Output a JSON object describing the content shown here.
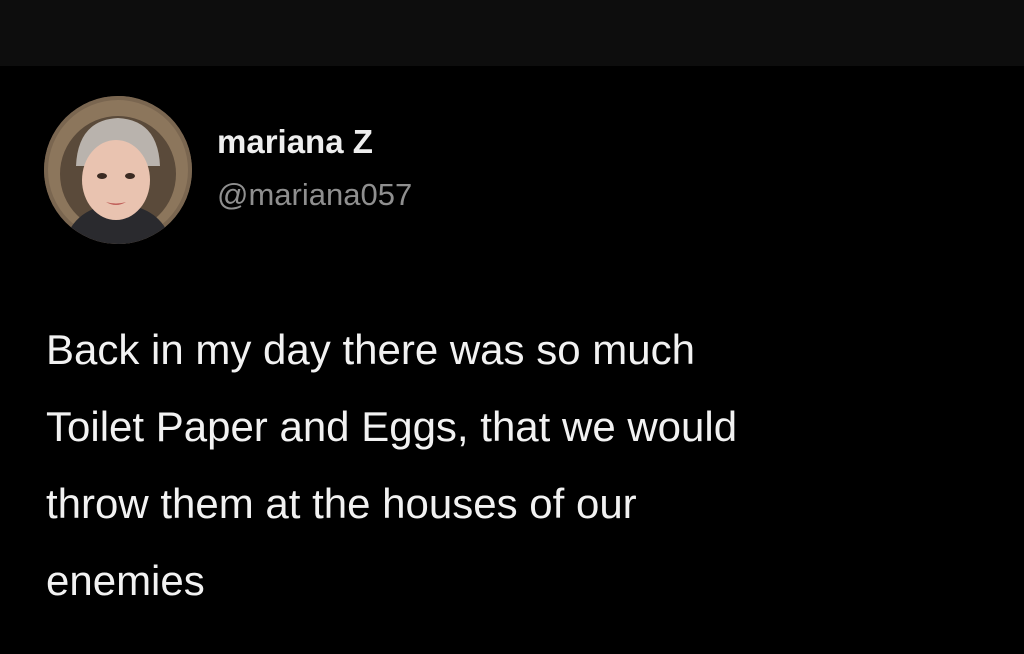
{
  "author": {
    "display_name": "mariana Z",
    "handle": "@mariana057",
    "avatar_icon": "profile-photo"
  },
  "tweet": {
    "lines": [
      "Back in my day there was so much",
      "Toilet Paper and Eggs, that we would",
      "throw them at the houses of our",
      "enemies"
    ]
  },
  "colors": {
    "background": "#000000",
    "top_bar": "#0d0d0d",
    "name": "#eeeeee",
    "handle": "#8f8f8f",
    "text": "#f2f2f2"
  }
}
